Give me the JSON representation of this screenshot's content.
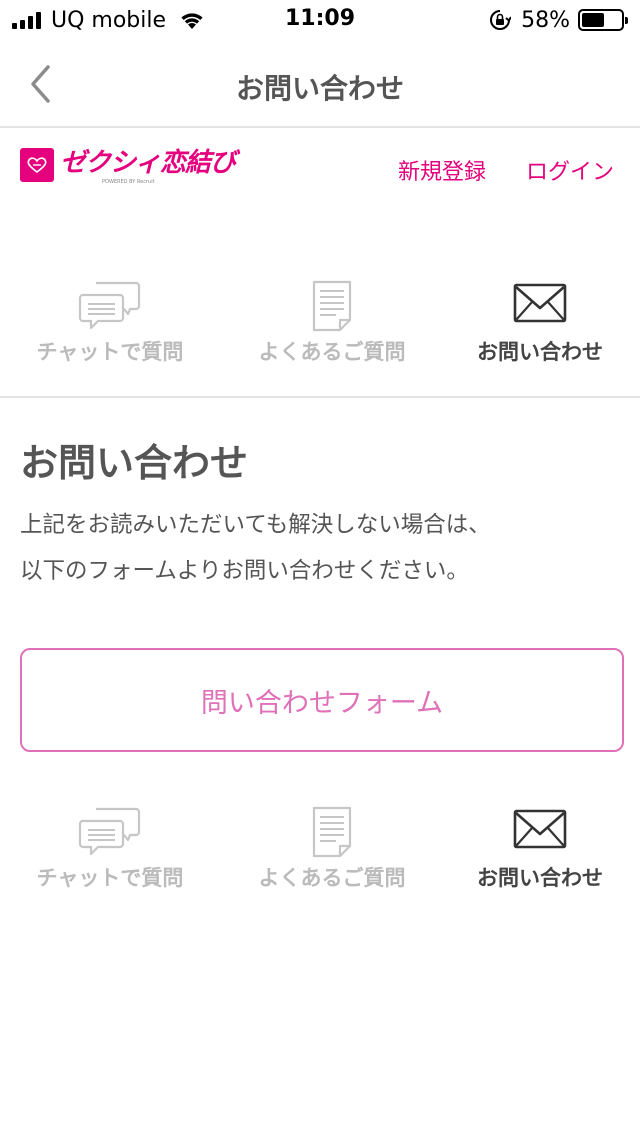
{
  "status_bar": {
    "carrier": "UQ mobile",
    "time": "11:09",
    "battery_percent": "58%",
    "battery_level": 0.58
  },
  "nav": {
    "title": "お問い合わせ",
    "back_icon": "chevron-left-icon"
  },
  "header": {
    "logo_text": "ゼクシィ恋結び",
    "logo_badge": "ゼクシィ恋結び",
    "logo_sub": "POWERED BY Recruit",
    "signup": "新規登録",
    "login": "ログイン"
  },
  "help_nav": [
    {
      "label": "チャットで質問",
      "icon": "chat-bubbles-icon",
      "active": false
    },
    {
      "label": "よくあるご質問",
      "icon": "document-icon",
      "active": false
    },
    {
      "label": "お問い合わせ",
      "icon": "envelope-icon",
      "active": true
    }
  ],
  "main": {
    "heading": "お問い合わせ",
    "desc_line1": "上記をお読みいただいても解決しない場合は、",
    "desc_line2": "以下のフォームよりお問い合わせください。",
    "form_button": "問い合わせフォーム"
  },
  "colors": {
    "brand": "#e5007e",
    "button": "#e070b8",
    "text": "#555555",
    "inactive": "#bbbbbb"
  }
}
